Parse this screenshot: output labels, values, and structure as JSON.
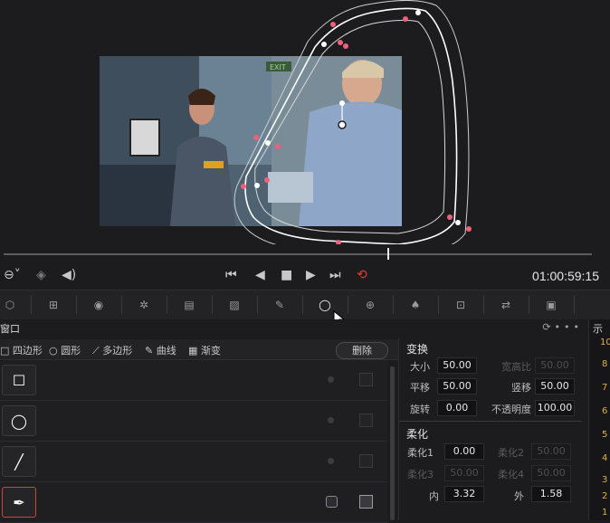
{
  "transport": {
    "timecode": "01:00:59:15"
  },
  "panel": {
    "title": "窗口"
  },
  "shape_tabs": [
    {
      "label": "四边形",
      "icon": "square-icon"
    },
    {
      "label": "圆形",
      "icon": "circle-icon"
    },
    {
      "label": "多边形",
      "icon": "polygon-icon"
    },
    {
      "label": "曲线",
      "icon": "pen-icon"
    },
    {
      "label": "渐变",
      "icon": "gradient-icon"
    }
  ],
  "delete_label": "删除",
  "transform": {
    "title": "变换",
    "size_label": "大小",
    "size": "50.00",
    "aspect_label": "宽高比",
    "aspect": "50.00",
    "pan_label": "平移",
    "pan": "50.00",
    "tilt_label": "竖移",
    "tilt": "50.00",
    "rotate_label": "旋转",
    "rotate": "0.00",
    "opacity_label": "不透明度",
    "opacity": "100.00"
  },
  "softness": {
    "title": "柔化",
    "soft1_label": "柔化1",
    "soft1": "0.00",
    "soft2_label": "柔化2",
    "soft2": "50.00",
    "soft3_label": "柔化3",
    "soft3": "50.00",
    "soft4_label": "柔化4",
    "soft4": "50.00",
    "inside_label": "内",
    "inside": "3.32",
    "outside_label": "外",
    "outside": "1.58"
  },
  "right_strip": {
    "title": "示",
    "numbers": [
      "10",
      "8",
      "7",
      "6",
      "5",
      "4",
      "3",
      "2",
      "1"
    ]
  },
  "video": {
    "exit_sign": "EXIT"
  }
}
